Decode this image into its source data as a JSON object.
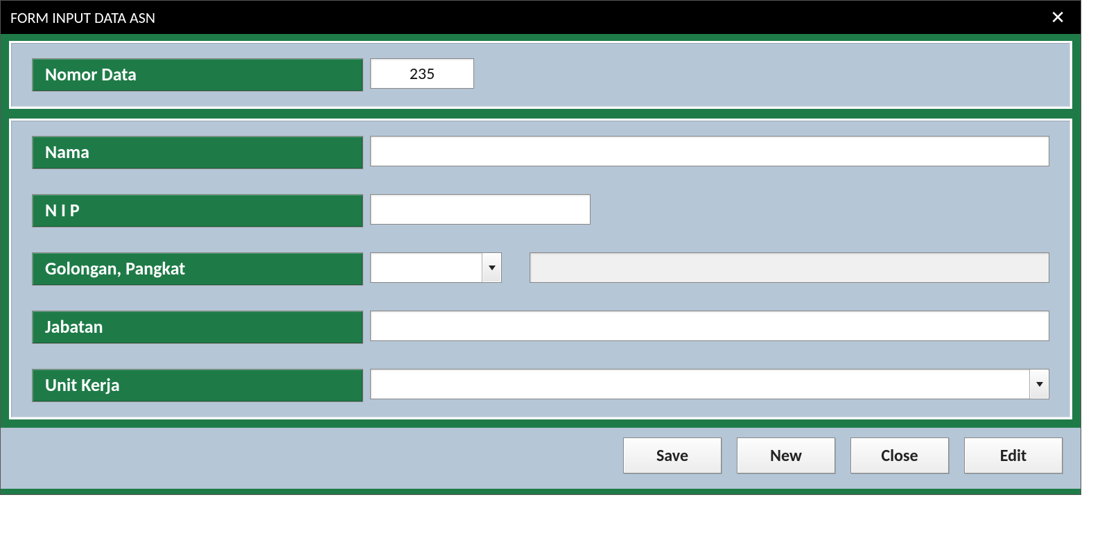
{
  "window": {
    "title": "FORM INPUT DATA ASN"
  },
  "top_panel": {
    "nomor_data_label": "Nomor Data",
    "nomor_data_value": "235"
  },
  "main_panel": {
    "nama_label": "Nama",
    "nama_value": "",
    "nip_label": "N I P",
    "nip_value": "",
    "golongan_label": "Golongan, Pangkat",
    "golongan_value": "",
    "golongan_output": "",
    "jabatan_label": "Jabatan",
    "jabatan_value": "",
    "unit_kerja_label": "Unit Kerja",
    "unit_kerja_value": ""
  },
  "buttons": {
    "save": "Save",
    "new": "New",
    "close": "Close",
    "edit": "Edit"
  }
}
